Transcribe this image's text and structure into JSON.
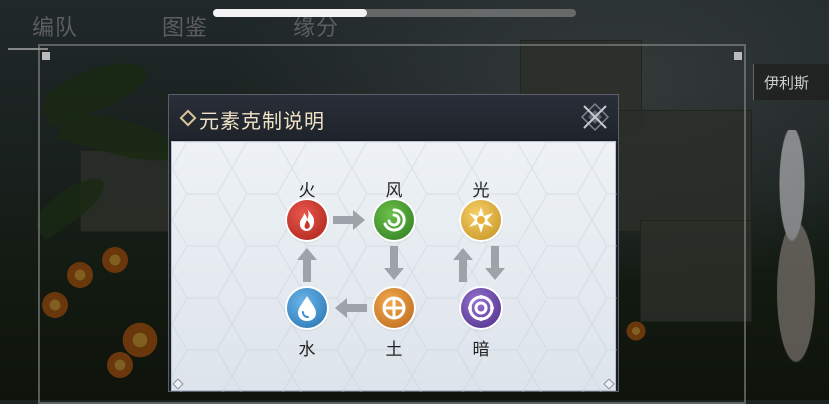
{
  "top_tabs": [
    "编队",
    "图鉴",
    "缘分"
  ],
  "character_tag": "伊利斯",
  "dialog": {
    "title": "元素克制说明",
    "elements": {
      "fire": "火",
      "wind": "风",
      "light": "光",
      "water": "水",
      "earth": "土",
      "dark": "暗"
    }
  },
  "colors": {
    "fire": "#c8362c",
    "wind": "#3f9a2e",
    "light": "#e7b13a",
    "water": "#3a8fd0",
    "earth": "#e28a2c",
    "dark": "#6b44a8",
    "arrow": "#9ea3a9",
    "dialog_title": "#efe3c7"
  },
  "icons": [
    "fire-icon",
    "wind-icon",
    "light-icon",
    "water-icon",
    "earth-icon",
    "dark-icon",
    "close-icon"
  ]
}
